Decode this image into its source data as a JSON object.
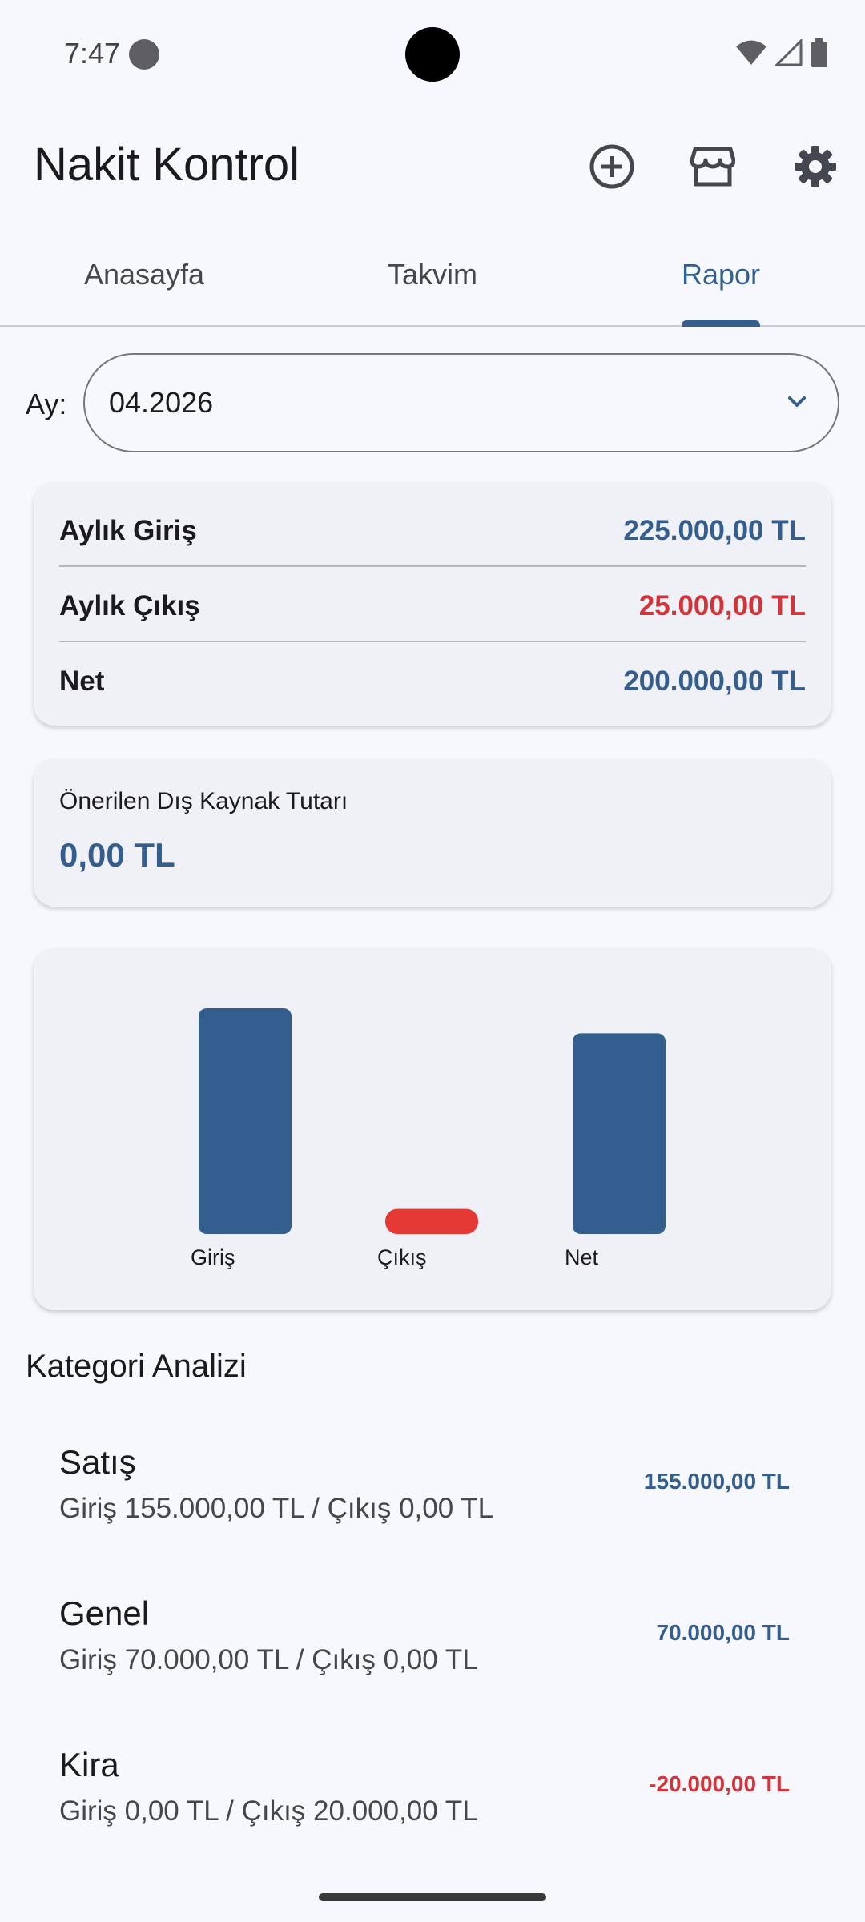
{
  "status_bar": {
    "time": "7:47"
  },
  "app_bar": {
    "title": "Nakit Kontrol",
    "actions": [
      {
        "icon": "add-circle-icon"
      },
      {
        "icon": "store-icon"
      },
      {
        "icon": "gear-icon"
      }
    ]
  },
  "tabs": [
    {
      "label": "Anasayfa",
      "active": false
    },
    {
      "label": "Takvim",
      "active": false
    },
    {
      "label": "Rapor",
      "active": true
    }
  ],
  "month_selector": {
    "label": "Ay:",
    "value": "04.2026"
  },
  "summary": {
    "rows": [
      {
        "label": "Aylık Giriş",
        "value": "225.000,00 TL",
        "color": "#335e8e"
      },
      {
        "label": "Aylık Çıkış",
        "value": "25.000,00 TL",
        "color": "#d2343a"
      },
      {
        "label": "Net",
        "value": "200.000,00 TL",
        "color": "#335e8e"
      }
    ]
  },
  "external": {
    "label": "Önerilen Dış Kaynak Tutarı",
    "value": "0,00 TL"
  },
  "chart_data": {
    "type": "bar",
    "categories": [
      "Giriş",
      "Çıkış",
      "Net"
    ],
    "values": [
      225000,
      25000,
      200000
    ],
    "colors": [
      "#335e8e",
      "#e53935",
      "#335e8e"
    ],
    "title": "",
    "xlabel": "",
    "ylabel": "",
    "grid": false
  },
  "category_analysis": {
    "title": "Kategori Analizi",
    "items": [
      {
        "name": "Satış",
        "detail": "Giriş 155.000,00 TL / Çıkış 0,00 TL",
        "amount": "155.000,00 TL",
        "color": "#335e8e"
      },
      {
        "name": "Genel",
        "detail": "Giriş 70.000,00 TL / Çıkış 0,00 TL",
        "amount": "70.000,00 TL",
        "color": "#335e8e"
      },
      {
        "name": "Kira",
        "detail": "Giriş 0,00 TL / Çıkış 20.000,00 TL",
        "amount": "-20.000,00 TL",
        "color": "#d2343a"
      }
    ]
  }
}
